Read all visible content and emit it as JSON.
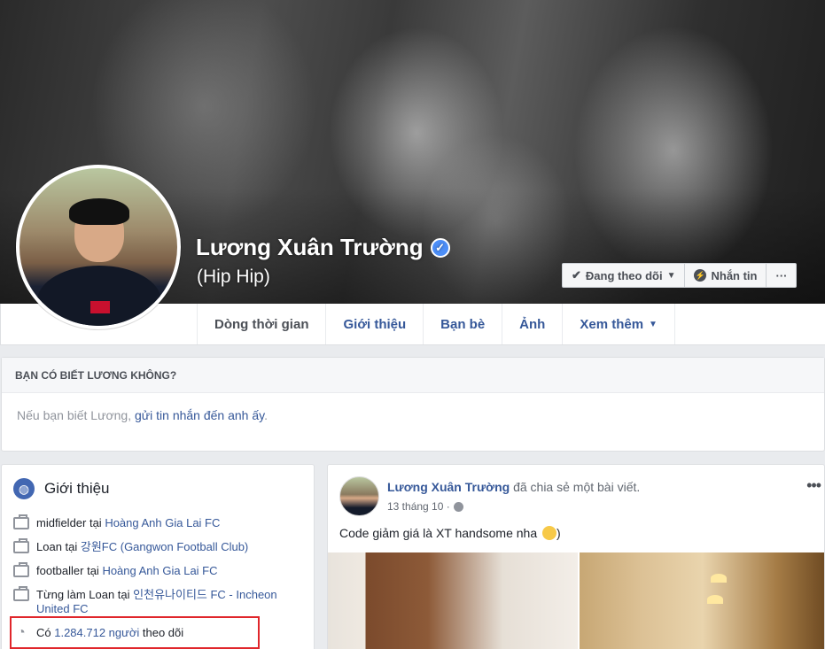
{
  "profile": {
    "name": "Lương Xuân Trường",
    "alternate_name": "(Hip Hip)",
    "verified_symbol": "✓"
  },
  "cover_buttons": {
    "following_label": "Đang theo dõi",
    "message_label": "Nhắn tin",
    "more_label": "···"
  },
  "tabs": [
    {
      "label": "Dòng thời gian"
    },
    {
      "label": "Giới thiệu"
    },
    {
      "label": "Bạn bè"
    },
    {
      "label": "Ảnh"
    },
    {
      "label": "Xem thêm"
    }
  ],
  "did_you_know": {
    "heading": "BẠN CÓ BIẾT LƯƠNG KHÔNG?",
    "text_before": "Nếu bạn biết Lương,",
    "link": "gửi tin nhắn đến anh ấy",
    "text_after": "."
  },
  "intro": {
    "title": "Giới thiệu",
    "items": [
      {
        "prefix": "midfielder tại ",
        "link": "Hoàng Anh Gia Lai FC"
      },
      {
        "prefix": "Loan tại ",
        "link": "강원FC (Gangwon Football Club)"
      },
      {
        "prefix": "footballer tại ",
        "link": "Hoàng Anh Gia Lai FC"
      },
      {
        "prefix": "Từng làm Loan tại ",
        "link": "인천유나이티드 FC - Incheon United FC"
      }
    ],
    "followers": {
      "prefix": "Có ",
      "link": "1.284.712 người",
      "suffix": " theo dõi"
    }
  },
  "post": {
    "author": "Lương Xuân Trường",
    "action": " đã chia sẻ một bài viết.",
    "date": "13 tháng 10 ·",
    "text": "Code giảm giá là XT handsome nha",
    "text_end": ")",
    "more": "•••"
  },
  "icons": {
    "verified": "verified-badge-icon",
    "check": "check-icon",
    "messenger": "messenger-icon",
    "globe": "globe-icon",
    "briefcase": "briefcase-icon",
    "rss": "rss-icon",
    "public": "public-globe-icon",
    "emoji": "smile-emoji-icon"
  },
  "colors": {
    "link": "#365899",
    "accent": "#4267b2",
    "highlight_border": "#e0262b"
  }
}
